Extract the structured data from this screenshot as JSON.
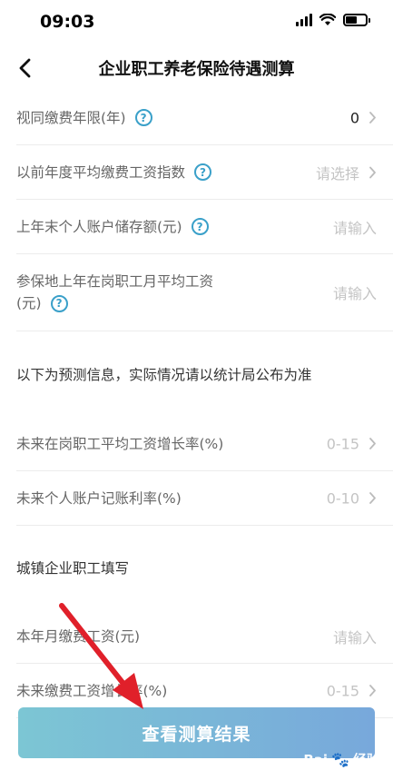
{
  "status_bar": {
    "time": "09:03"
  },
  "header": {
    "title": "企业职工养老保险待遇测算"
  },
  "form": {
    "rows": [
      {
        "label": "视同缴费年限(年)",
        "value": "0"
      },
      {
        "label": "以前年度平均缴费工资指数",
        "placeholder": "请选择"
      },
      {
        "label": "上年末个人账户储存额(元)",
        "placeholder": "请输入"
      },
      {
        "label_line1": "参保地上年在岗职工月平均工资",
        "label_line2": "(元)",
        "placeholder": "请输入"
      }
    ],
    "prediction_section": {
      "title": "以下为预测信息，实际情况请以统计局公布为准",
      "rows": [
        {
          "label": "未来在岗职工平均工资增长率(%)",
          "placeholder": "0-15"
        },
        {
          "label": "未来个人账户记账利率(%)",
          "placeholder": "0-10"
        }
      ]
    },
    "urban_section": {
      "title": "城镇企业职工填写",
      "rows": [
        {
          "label": "本年月缴费工资(元)",
          "placeholder": "请输入"
        },
        {
          "label": "未来缴费工资增长率(%)",
          "placeholder": "0-15"
        }
      ]
    }
  },
  "submit_button": {
    "label": "查看测算结果"
  },
  "watermark": {
    "text": "Bai",
    "text2": "经验"
  },
  "colors": {
    "accent": "#3aa0c9",
    "button_start": "#7cc6d4",
    "button_end": "#78a8db",
    "arrow": "#e0202a"
  }
}
